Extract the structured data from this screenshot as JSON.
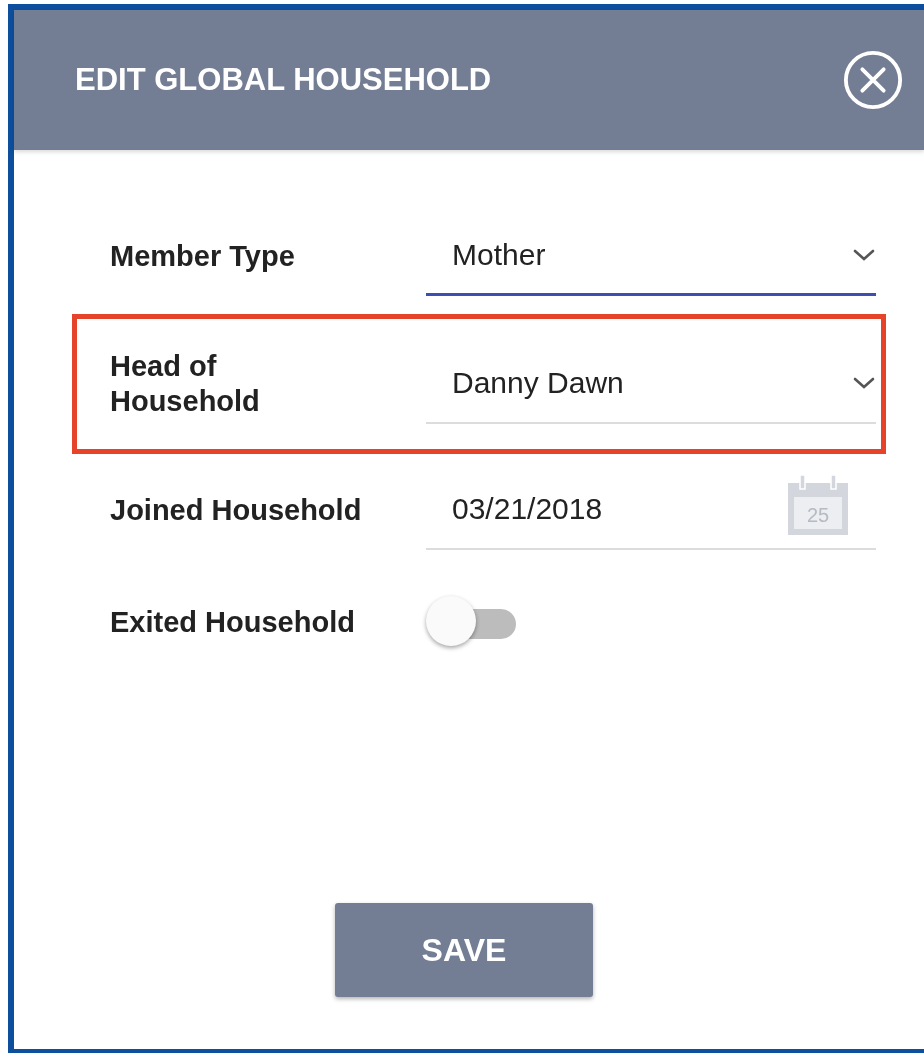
{
  "dialog": {
    "title": "EDIT GLOBAL HOUSEHOLD"
  },
  "fields": [
    {
      "kind": "select",
      "label": "Member Type",
      "value": "Mother",
      "focused": true,
      "highlighted": false
    },
    {
      "kind": "select",
      "label": "Head of\nHousehold",
      "value": "Danny Dawn",
      "focused": false,
      "highlighted": true
    },
    {
      "kind": "date",
      "label": "Joined Household",
      "value": "03/21/2018",
      "calendar_day": "25",
      "focused": false,
      "highlighted": false
    },
    {
      "kind": "toggle",
      "label": "Exited Household",
      "on": false
    }
  ],
  "save_button": "SAVE"
}
